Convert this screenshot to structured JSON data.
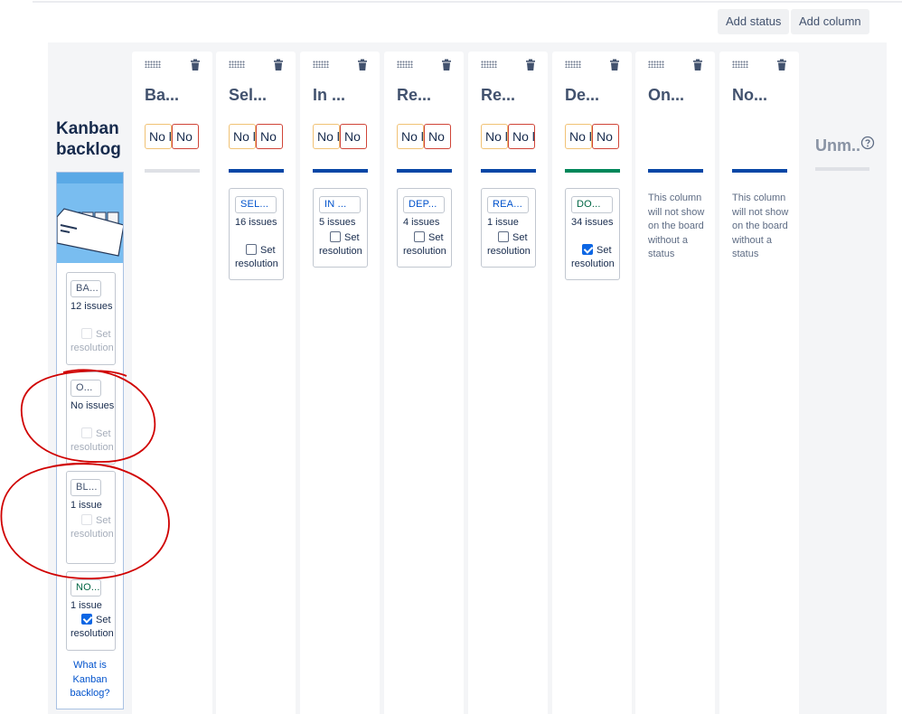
{
  "toolbar": {
    "add_status": "Add status",
    "add_column": "Add column"
  },
  "backlog": {
    "title": "Kanban backlog",
    "cards": [
      {
        "status": "BA...",
        "count": "12 issues",
        "resolution_label": "Set resolution",
        "checked": false,
        "style": "gray"
      },
      {
        "status": "O...",
        "count": "No issues",
        "resolution_label": "Set resolution",
        "checked": false,
        "style": "gray"
      },
      {
        "status": "BL...",
        "count": "1 issue",
        "resolution_label": "Set resolution",
        "checked": false,
        "style": "gray"
      },
      {
        "status": "NO...",
        "count": "1 issue",
        "resolution_label": "Set resolution",
        "checked": true,
        "style": "green"
      }
    ],
    "help_link": "What is Kanban backlog?"
  },
  "columns": [
    {
      "name": "Ba...",
      "min": "No l",
      "max": "No",
      "bar_color": "#dfe1e6",
      "card": null,
      "empty_text": ""
    },
    {
      "name": "Sel...",
      "min": "No l",
      "max": "No",
      "bar_color": "#0747a6",
      "card": {
        "status": "SEL...",
        "count": "16 issues",
        "resolution_label": "Set resolution",
        "checked": false,
        "style": "blue"
      },
      "empty_text": ""
    },
    {
      "name": "In ...",
      "min": "No l",
      "max": "No",
      "bar_color": "#0747a6",
      "card": {
        "status": "IN ...",
        "count": "5 issues",
        "resolution_label": "Set resolution",
        "checked": false,
        "style": "blue"
      },
      "empty_text": ""
    },
    {
      "name": "Re...",
      "min": "No l",
      "max": "No",
      "bar_color": "#0747a6",
      "card": {
        "status": "DEP...",
        "count": "4 issues",
        "resolution_label": "Set resolution",
        "checked": false,
        "style": "blue"
      },
      "empty_text": ""
    },
    {
      "name": "Re...",
      "min": "No l",
      "max": "No l",
      "bar_color": "#0747a6",
      "card": {
        "status": "REA...",
        "count": "1 issue",
        "resolution_label": "Set resolution",
        "checked": false,
        "style": "blue"
      },
      "empty_text": ""
    },
    {
      "name": "De...",
      "min": "No l",
      "max": "No",
      "bar_color": "#00875a",
      "card": {
        "status": "DO...",
        "count": "34 issues",
        "resolution_label": "Set resolution",
        "checked": true,
        "style": "green"
      },
      "empty_text": ""
    },
    {
      "name": "On...",
      "min": "",
      "max": "",
      "bar_color": "#0747a6",
      "card": null,
      "empty_text": "This column will not show on the board without a status"
    },
    {
      "name": "No...",
      "min": "",
      "max": "",
      "bar_color": "#0747a6",
      "card": null,
      "empty_text": "This column will not show on the board without a status"
    }
  ],
  "unmapped": {
    "label": "Unm..",
    "help_icon": "question-circle-icon"
  },
  "annotation_color": "#d00000"
}
